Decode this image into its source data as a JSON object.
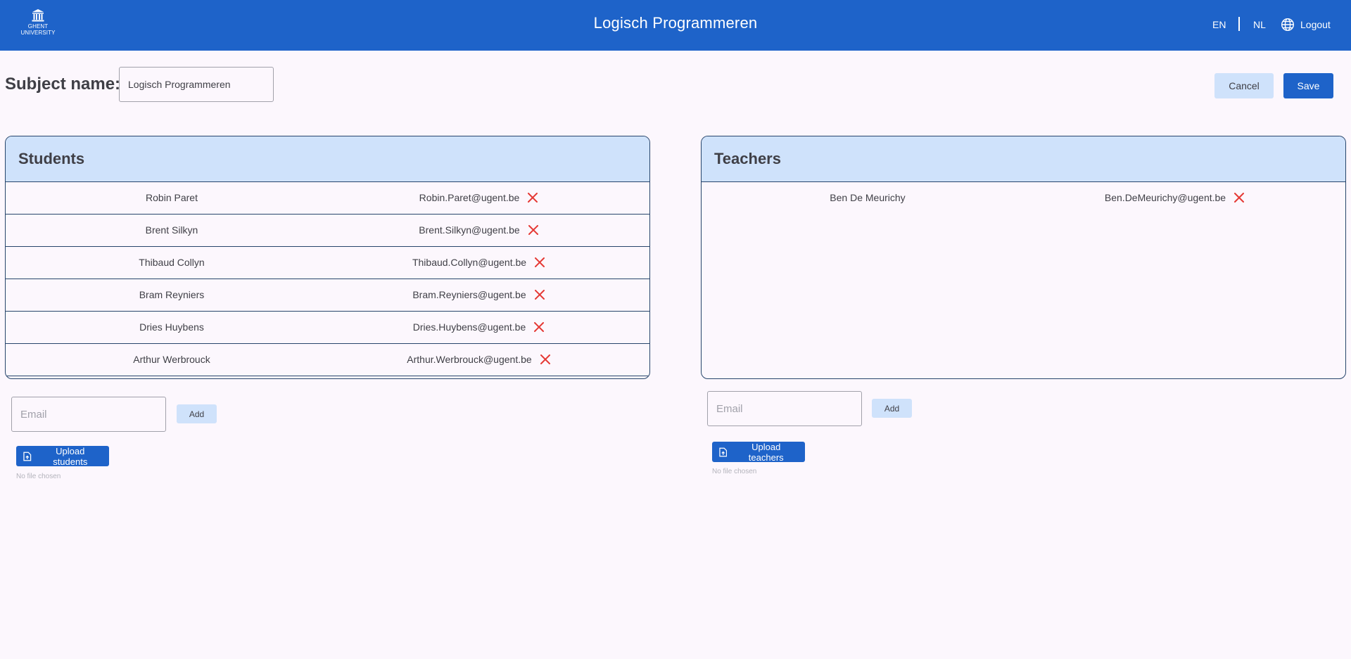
{
  "header": {
    "logo_text": "GHENT\nUNIVERSITY",
    "title": "Logisch Programmeren",
    "lang_en": "EN",
    "lang_nl": "NL",
    "logout_label": "Logout"
  },
  "subject": {
    "label": "Subject name:",
    "value": "Logisch Programmeren"
  },
  "actions": {
    "cancel_label": "Cancel",
    "save_label": "Save"
  },
  "students": {
    "title": "Students",
    "rows": [
      {
        "name": "Robin Paret",
        "email": "Robin.Paret@ugent.be"
      },
      {
        "name": "Brent Silkyn",
        "email": "Brent.Silkyn@ugent.be"
      },
      {
        "name": "Thibaud Collyn",
        "email": "Thibaud.Collyn@ugent.be"
      },
      {
        "name": "Bram Reyniers",
        "email": "Bram.Reyniers@ugent.be"
      },
      {
        "name": "Dries Huybens",
        "email": "Dries.Huybens@ugent.be"
      },
      {
        "name": "Arthur Werbrouck",
        "email": "Arthur.Werbrouck@ugent.be"
      }
    ],
    "email_placeholder": "Email",
    "add_label": "Add",
    "upload_label": "Upload students",
    "no_file_text": "No file chosen"
  },
  "teachers": {
    "title": "Teachers",
    "rows": [
      {
        "name": "Ben De Meurichy",
        "email": "Ben.DeMeurichy@ugent.be"
      }
    ],
    "email_placeholder": "Email",
    "add_label": "Add",
    "upload_label": "Upload teachers",
    "no_file_text": "No file chosen"
  },
  "icons": {
    "remove": "close-icon",
    "upload": "file-upload-icon",
    "language": "globe-icon",
    "logo": "university-building-icon"
  },
  "colors": {
    "primary": "#1e63c9",
    "light_blue": "#cfe2fb",
    "remove_red": "#e53935",
    "border": "#27456b",
    "background": "#fcf7fd"
  }
}
